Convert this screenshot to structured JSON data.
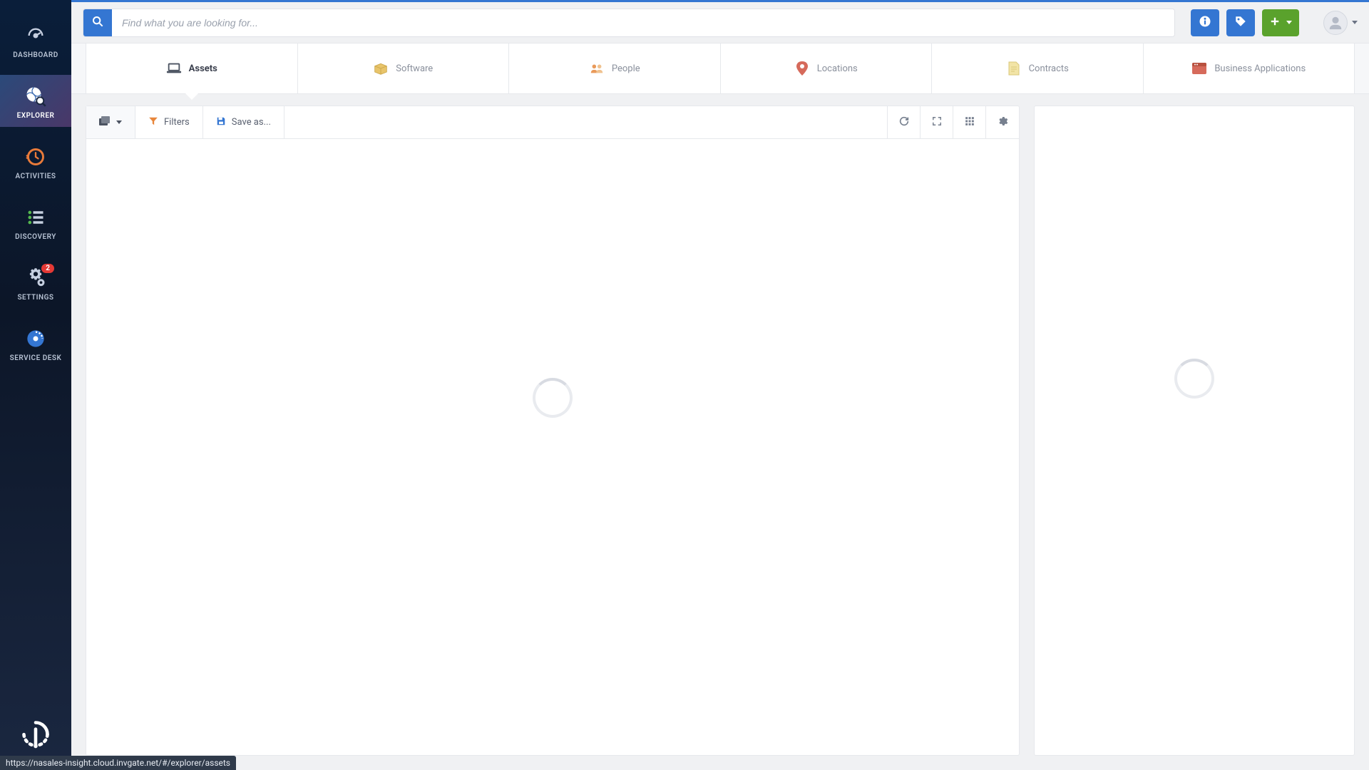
{
  "sidebar": {
    "items": [
      {
        "label": "DASHBOARD"
      },
      {
        "label": "EXPLORER"
      },
      {
        "label": "ACTIVITIES"
      },
      {
        "label": "DISCOVERY"
      },
      {
        "label": "SETTINGS",
        "badge": "2"
      },
      {
        "label": "SERVICE DESK"
      }
    ]
  },
  "search": {
    "placeholder": "Find what you are looking for..."
  },
  "tabs": [
    {
      "label": "Assets"
    },
    {
      "label": "Software"
    },
    {
      "label": "People"
    },
    {
      "label": "Locations"
    },
    {
      "label": "Contracts"
    },
    {
      "label": "Business Applications"
    }
  ],
  "toolbar": {
    "filters_label": "Filters",
    "save_as_label": "Save as..."
  },
  "statusbar_url": "https://nasales-insight.cloud.invgate.net/#/explorer/assets"
}
